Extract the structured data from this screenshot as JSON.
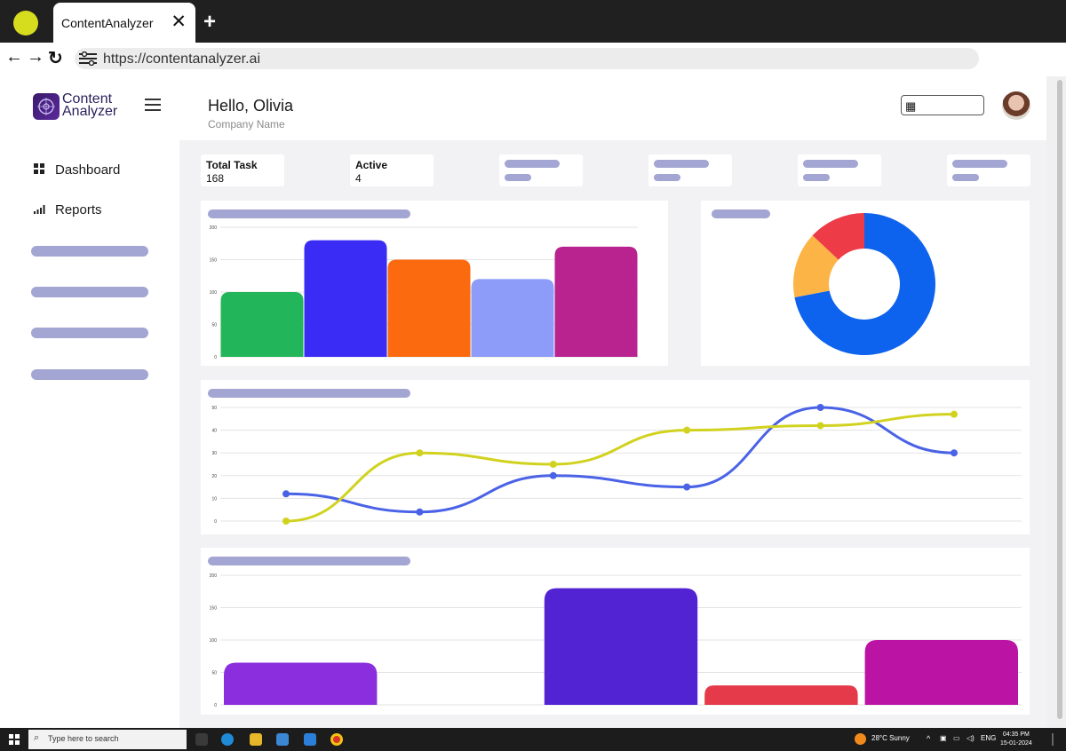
{
  "browser": {
    "tab_title": "ContentAnalyzer",
    "url": "https://contentanalyzer.ai"
  },
  "sidebar": {
    "logo_line1": "Content",
    "logo_line2": "Analyzer",
    "items": [
      {
        "label": "Dashboard",
        "icon": "grid-icon"
      },
      {
        "label": "Reports",
        "icon": "bar-chart-icon"
      }
    ]
  },
  "header": {
    "greeting": "Hello, Olivia",
    "company": "Company Name"
  },
  "stats": [
    {
      "label": "Total Task",
      "value": "168"
    },
    {
      "label": "Active",
      "value": "4"
    }
  ],
  "colors": {
    "placeholder": "#a3a5d2",
    "donut_blue": "#0d62ee",
    "donut_orange": "#fdb447",
    "donut_red": "#ee3b48",
    "line_blue": "#4a62e6",
    "line_yellow": "#d1d21f"
  },
  "charts": {
    "bar_top": {
      "type": "bar",
      "ylim": [
        0,
        200
      ],
      "ticks": [
        0,
        50,
        100,
        150,
        200
      ],
      "values": [
        100,
        180,
        150,
        120,
        170
      ],
      "colors": [
        "#23b55a",
        "#3a2cf5",
        "#fb6a0e",
        "#8c9cf8",
        "#b8238f"
      ]
    },
    "donut": {
      "type": "pie",
      "values": [
        72,
        15,
        13
      ],
      "colors": [
        "#0d62ee",
        "#fdb447",
        "#ee3b48"
      ]
    },
    "line": {
      "type": "line",
      "ylim": [
        0,
        50
      ],
      "ticks": [
        0,
        10,
        20,
        30,
        40,
        50
      ],
      "series": [
        {
          "values": [
            12,
            4,
            20,
            15,
            50,
            30
          ],
          "color": "#4a62e6"
        },
        {
          "values": [
            0,
            30,
            25,
            40,
            42,
            47
          ],
          "color": "#d1d21f"
        }
      ]
    },
    "bar_bottom": {
      "type": "bar",
      "ylim": [
        0,
        200
      ],
      "ticks": [
        0,
        50,
        100,
        150,
        200
      ],
      "values": [
        65,
        0,
        180,
        30,
        100
      ],
      "colors": [
        "#8a2ede",
        "#8a2ede",
        "#5223d3",
        "#e43a4a",
        "#bb14a5"
      ]
    }
  },
  "taskbar": {
    "search_placeholder": "Type here to search",
    "weather": "28°C  Sunny",
    "lang": "ENG",
    "time": "04:35 PM",
    "date": "15-01-2024"
  }
}
